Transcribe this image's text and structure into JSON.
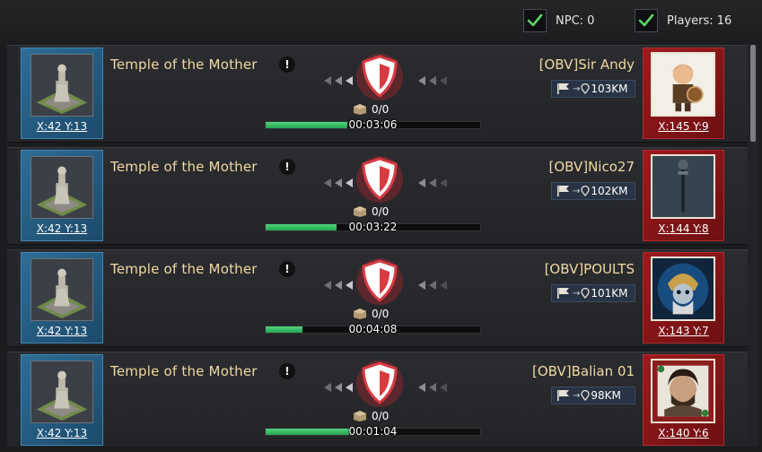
{
  "filters": {
    "npc": {
      "label": "NPC: 0",
      "checked": true
    },
    "players": {
      "label": "Players: 16",
      "checked": true
    }
  },
  "colors": {
    "check": "#5fd36b",
    "target_tile": "#2e6d97",
    "player_banner": "#9c1b1e",
    "progress": "#2dba5c",
    "name_gold": "#f0d9a3"
  },
  "icons": {
    "info": "!",
    "distance_arrow": "→"
  },
  "marches": [
    {
      "target_name": "Temple of the Mother",
      "target_coords": "X:42 Y:13",
      "cargo": "0/0",
      "timer": "00:03:06",
      "progress": 0.38,
      "player_name": "[OBV]Sir Andy",
      "distance": "103KM",
      "player_coords": "X:145 Y:9"
    },
    {
      "target_name": "Temple of the Mother",
      "target_coords": "X:42 Y:13",
      "cargo": "0/0",
      "timer": "00:03:22",
      "progress": 0.33,
      "player_name": "[OBV]Nico27",
      "distance": "102KM",
      "player_coords": "X:144 Y:8"
    },
    {
      "target_name": "Temple of the Mother",
      "target_coords": "X:42 Y:13",
      "cargo": "0/0",
      "timer": "00:04:08",
      "progress": 0.17,
      "player_name": "[OBV]POULTS",
      "distance": "101KM",
      "player_coords": "X:143 Y:7"
    },
    {
      "target_name": "Temple of the Mother",
      "target_coords": "X:42 Y:13",
      "cargo": "0/0",
      "timer": "00:01:04",
      "progress": 0.39,
      "player_name": "[OBV]Balian 01",
      "distance": "98KM",
      "player_coords": "X:140 Y:6"
    }
  ]
}
